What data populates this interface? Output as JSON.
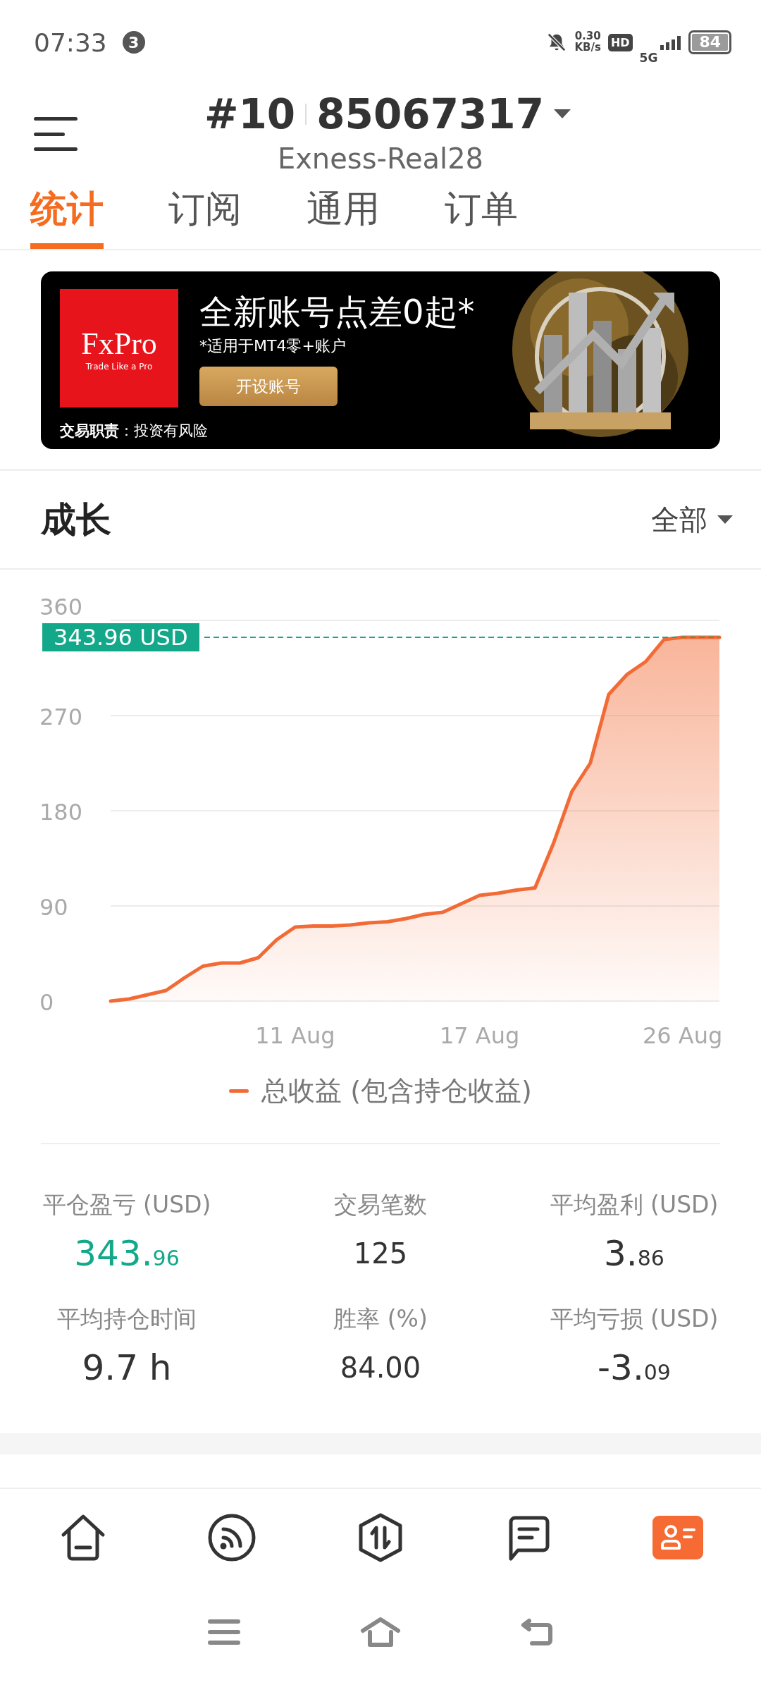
{
  "status_bar": {
    "time": "07:33",
    "notification_count": "3",
    "speed": "0.30",
    "speed_unit": "KB/s",
    "hd": "HD",
    "network": "5G",
    "battery": "84"
  },
  "header": {
    "account_prefix": "#10",
    "account_number": "85067317",
    "server": "Exness-Real28"
  },
  "tabs": [
    {
      "label": "统计",
      "selected": true
    },
    {
      "label": "订阅",
      "selected": false
    },
    {
      "label": "通用",
      "selected": false
    },
    {
      "label": "订单",
      "selected": false
    }
  ],
  "banner": {
    "brand": "FxPro",
    "tagline": "Trade Like a Pro",
    "headline": "全新账号点差0起*",
    "subline": "*适用于MT4零+账户",
    "button": "开设账号",
    "disclaimer": "**交易职责**：投资有风险"
  },
  "growth": {
    "title": "成长",
    "filter": "全部",
    "chart_data": {
      "type": "area",
      "categories": [
        null,
        null,
        null,
        null,
        null,
        null,
        null,
        null,
        null,
        null,
        "11 Aug",
        null,
        null,
        null,
        null,
        null,
        null,
        null,
        null,
        null,
        "17 Aug",
        null,
        null,
        null,
        null,
        null,
        null,
        null,
        null,
        null,
        null,
        "26 Aug",
        null,
        null
      ],
      "series": [
        {
          "name": "总收益 (包含持仓收益)",
          "color": "#f26b36",
          "values": [
            0,
            2,
            6,
            10,
            22,
            33,
            36,
            36,
            41,
            58,
            70,
            71,
            71,
            72,
            74,
            75,
            78,
            82,
            84,
            92,
            100,
            102,
            105,
            107,
            149,
            198,
            225,
            290,
            309,
            321,
            342,
            344,
            344,
            344
          ]
        }
      ],
      "ylim": [
        0,
        360
      ],
      "yticks": [
        0,
        90,
        180,
        270,
        360
      ],
      "grid": true,
      "ref_lines": [
        {
          "axis": "y",
          "value": 343.96,
          "label": "343.96 USD",
          "color": "#13a88a"
        }
      ]
    }
  },
  "stats": [
    {
      "label": "平仓盈亏 (USD)",
      "kind": "split",
      "main": "343.",
      "fraction": "96",
      "color": "#13a88a"
    },
    {
      "label": "交易笔数",
      "kind": "plain",
      "main": "125",
      "color": "#333333"
    },
    {
      "label": "平均盈利 (USD)",
      "kind": "split",
      "main": "3.",
      "fraction": "86",
      "color": "#333333"
    },
    {
      "label": "平均持仓时间",
      "kind": "large",
      "main": "9.7 h",
      "color": "#333333"
    },
    {
      "label": "胜率 (%)",
      "kind": "plain",
      "main": "84.00",
      "color": "#333333"
    },
    {
      "label": "平均亏损 (USD)",
      "kind": "split",
      "main": "-3.",
      "fraction": "09",
      "color": "#333333"
    }
  ],
  "bottom_nav": [
    {
      "kind": "home",
      "selected": false
    },
    {
      "kind": "feed",
      "selected": false
    },
    {
      "kind": "trade",
      "selected": false
    },
    {
      "kind": "message",
      "selected": false
    },
    {
      "kind": "profile",
      "selected": true
    }
  ]
}
